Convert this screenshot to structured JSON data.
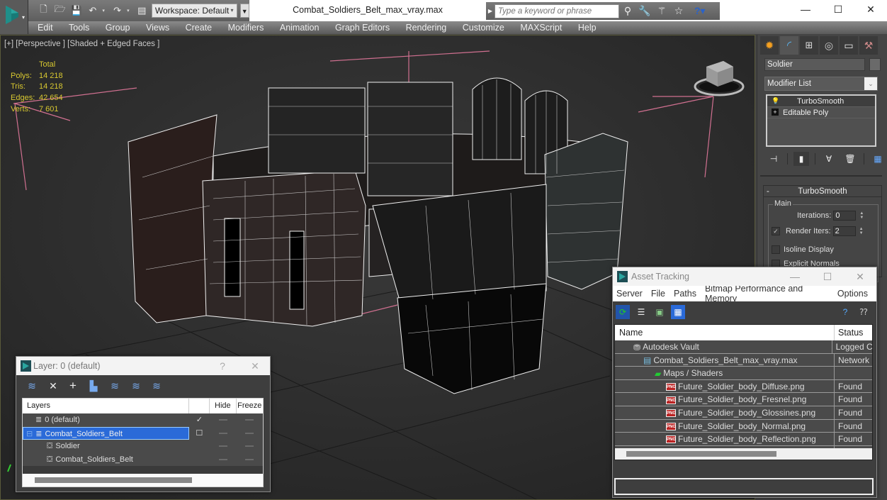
{
  "app": {
    "window_title": "Combat_Soldiers_Belt_max_vray.max",
    "workspace": "Workspace: Default",
    "search_placeholder": "Type a keyword or phrase",
    "window_controls": {
      "minimize": "—",
      "maximize": "☐",
      "close": "✕"
    }
  },
  "menu": [
    "Edit",
    "Tools",
    "Group",
    "Views",
    "Create",
    "Modifiers",
    "Animation",
    "Graph Editors",
    "Rendering",
    "Customize",
    "MAXScript",
    "Help"
  ],
  "viewport": {
    "label": "[+] [Perspective ] [Shaded + Edged Faces ]",
    "stats": {
      "header": "Total",
      "rows": [
        {
          "label": "Polys:",
          "value": "14 218"
        },
        {
          "label": "Tris:",
          "value": "14 218"
        },
        {
          "label": "Edges:",
          "value": "42 654"
        },
        {
          "label": "Verts:",
          "value": "7 601"
        }
      ]
    }
  },
  "command_panel": {
    "tabs": [
      "create",
      "modify",
      "hierarchy",
      "motion",
      "display",
      "utilities"
    ],
    "active_tab": "modify",
    "object_name": "Soldier",
    "modifier_list_label": "Modifier List",
    "stack": [
      {
        "label": "TurboSmooth",
        "icon": "lightbulb-icon",
        "selected": true
      },
      {
        "label": "Editable Poly",
        "icon": "plus-icon",
        "selected": false
      }
    ],
    "rollout": {
      "title": "TurboSmooth",
      "group": "Main",
      "iterations_label": "Iterations:",
      "iterations_value": "0",
      "render_iters_label": "Render Iters:",
      "render_iters_value": "2",
      "render_iters_checked": true,
      "isoline_label": "Isoline Display",
      "isoline_checked": false,
      "explicit_normals_label": "Explicit Normals",
      "explicit_normals_checked": false
    }
  },
  "asset_tracking": {
    "title": "Asset Tracking",
    "menu": [
      "Server",
      "File",
      "Paths",
      "Bitmap Performance and Memory",
      "Options"
    ],
    "columns": [
      "Name",
      "Status"
    ],
    "rows": [
      {
        "name": "Autodesk Vault",
        "status": "Logged C",
        "icon": "vault-icon",
        "indent": 1
      },
      {
        "name": "Combat_Soldiers_Belt_max_vray.max",
        "status": "Network",
        "icon": "max-file-icon",
        "indent": 2
      },
      {
        "name": "Maps / Shaders",
        "status": "",
        "icon": "maps-icon",
        "indent": 3
      },
      {
        "name": "Future_Soldier_body_Diffuse.png",
        "status": "Found",
        "icon": "png-icon",
        "indent": 4
      },
      {
        "name": "Future_Soldier_body_Fresnel.png",
        "status": "Found",
        "icon": "png-icon",
        "indent": 4
      },
      {
        "name": "Future_Soldier_body_Glossines.png",
        "status": "Found",
        "icon": "png-icon",
        "indent": 4
      },
      {
        "name": "Future_Soldier_body_Normal.png",
        "status": "Found",
        "icon": "png-icon",
        "indent": 4
      },
      {
        "name": "Future_Soldier_body_Reflection.png",
        "status": "Found",
        "icon": "png-icon",
        "indent": 4
      }
    ]
  },
  "layer_window": {
    "title": "Layer: 0 (default)",
    "help": "?",
    "close": "✕",
    "columns": [
      "Layers",
      "",
      "Hide",
      "Freeze"
    ],
    "rows": [
      {
        "name": "0 (default)",
        "icon": "layer-icon",
        "indent": 1,
        "active_mark": "✓",
        "selected": false
      },
      {
        "name": "Combat_Soldiers_Belt",
        "icon": "layer-icon",
        "indent": 1,
        "active_mark": "☐",
        "selected": true
      },
      {
        "name": "Soldier",
        "icon": "object-icon",
        "indent": 2,
        "active_mark": "",
        "selected": false
      },
      {
        "name": "Combat_Soldiers_Belt",
        "icon": "object-icon",
        "indent": 2,
        "active_mark": "",
        "selected": false
      }
    ]
  }
}
